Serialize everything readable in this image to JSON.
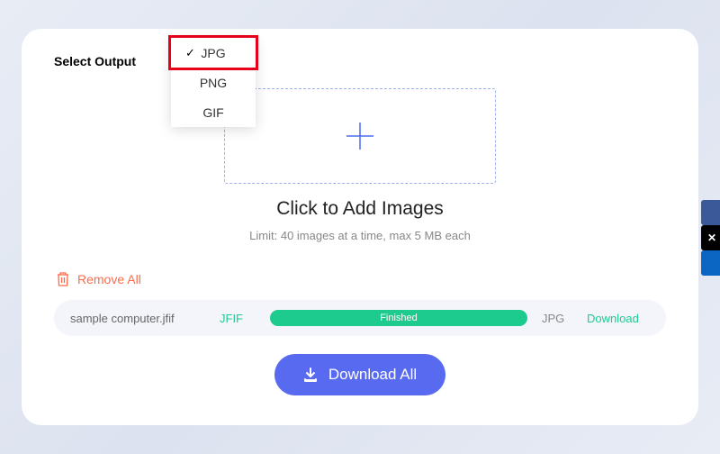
{
  "labels": {
    "select_output": "Select Output"
  },
  "format_dropdown": {
    "options": [
      "JPG",
      "PNG",
      "GIF"
    ],
    "selected": "JPG"
  },
  "dropzone": {
    "title": "Click to Add Images",
    "limit": "Limit: 40 images at a time, max 5 MB each"
  },
  "actions": {
    "remove_all": "Remove All",
    "download_all": "Download All"
  },
  "file": {
    "name": "sample computer.jfif",
    "source_format": "JFIF",
    "progress_label": "Finished",
    "target_format": "JPG",
    "download_label": "Download"
  },
  "side_tabs": [
    "",
    "✕",
    ""
  ]
}
